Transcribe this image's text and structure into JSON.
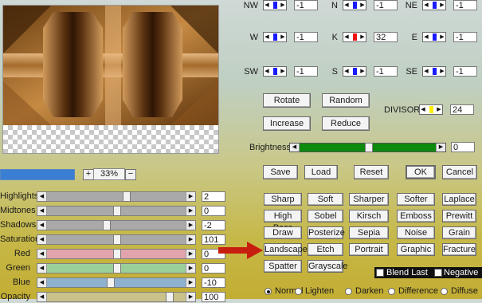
{
  "preview": {
    "zoom": "33%",
    "zoom_plus": "+",
    "zoom_minus": "−"
  },
  "adjustments": [
    {
      "label": "Highlights",
      "value": "2",
      "thumb_pct": 57,
      "color": "#a9a9a9"
    },
    {
      "label": "Midtones",
      "value": "0",
      "thumb_pct": 50,
      "color": "#a9a9a9"
    },
    {
      "label": "Shadows",
      "value": "-2",
      "thumb_pct": 42,
      "color": "#a9a9a9"
    },
    {
      "label": "Saturation",
      "value": "101",
      "thumb_pct": 50,
      "color": "#a9a9a9"
    },
    {
      "label": "Red",
      "value": "0",
      "thumb_pct": 50,
      "color": "#e2a4ac"
    },
    {
      "label": "Green",
      "value": "0",
      "thumb_pct": 50,
      "color": "#9acf9a"
    },
    {
      "label": "Blue",
      "value": "-10",
      "thumb_pct": 45,
      "color": "#8fb1d0"
    },
    {
      "label": "Opacity",
      "value": "100",
      "thumb_pct": 90,
      "color": "#c9c18a"
    }
  ],
  "matrix": [
    {
      "label": "NW",
      "value": "-1",
      "indicator": "#1a1aff"
    },
    {
      "label": "N",
      "value": "-1",
      "indicator": "#1a1aff"
    },
    {
      "label": "NE",
      "value": "-1",
      "indicator": "#1a1aff"
    },
    {
      "label": "W",
      "value": "-1",
      "indicator": "#1a1aff"
    },
    {
      "label": "K",
      "value": "32",
      "indicator": "#ee1111"
    },
    {
      "label": "E",
      "value": "-1",
      "indicator": "#1a1aff"
    },
    {
      "label": "SW",
      "value": "-1",
      "indicator": "#1a1aff"
    },
    {
      "label": "S",
      "value": "-1",
      "indicator": "#1a1aff"
    },
    {
      "label": "SE",
      "value": "-1",
      "indicator": "#1a1aff"
    }
  ],
  "matrix_buttons": {
    "rotate": "Rotate",
    "random": "Random",
    "increase": "Increase",
    "reduce": "Reduce"
  },
  "divisor": {
    "label": "DIVISOR",
    "value": "24",
    "indicator": "#ffee00"
  },
  "brightness": {
    "label": "Brightness",
    "value": "0",
    "level_pct": 50
  },
  "actions": {
    "save": "Save",
    "load": "Load",
    "reset": "Reset",
    "ok": "OK",
    "cancel": "Cancel"
  },
  "filters": [
    [
      "Sharp",
      "Soft",
      "Sharper",
      "Softer",
      "Laplace"
    ],
    [
      "High Pass",
      "Sobel",
      "Kirsch",
      "Emboss",
      "Prewitt"
    ],
    [
      "Draw",
      "Posterize",
      "Sepia",
      "Noise",
      "Grain"
    ],
    [
      "Landscape",
      "Etch",
      "Portrait",
      "Graphic",
      "Fracture"
    ],
    [
      "Spatter",
      "Grayscale"
    ]
  ],
  "options": {
    "blend_last": "Blend Last",
    "negative": "Negative"
  },
  "blend_modes": [
    {
      "label": "Normal",
      "selected": true
    },
    {
      "label": "Lighten",
      "selected": false
    },
    {
      "label": "Darken",
      "selected": false
    },
    {
      "label": "Difference",
      "selected": false
    },
    {
      "label": "Diffuse",
      "selected": false
    }
  ],
  "colors": {
    "arrow": "#c81e10",
    "brightness_track": "#0c8a0c",
    "progress": "#3b7fd4"
  }
}
